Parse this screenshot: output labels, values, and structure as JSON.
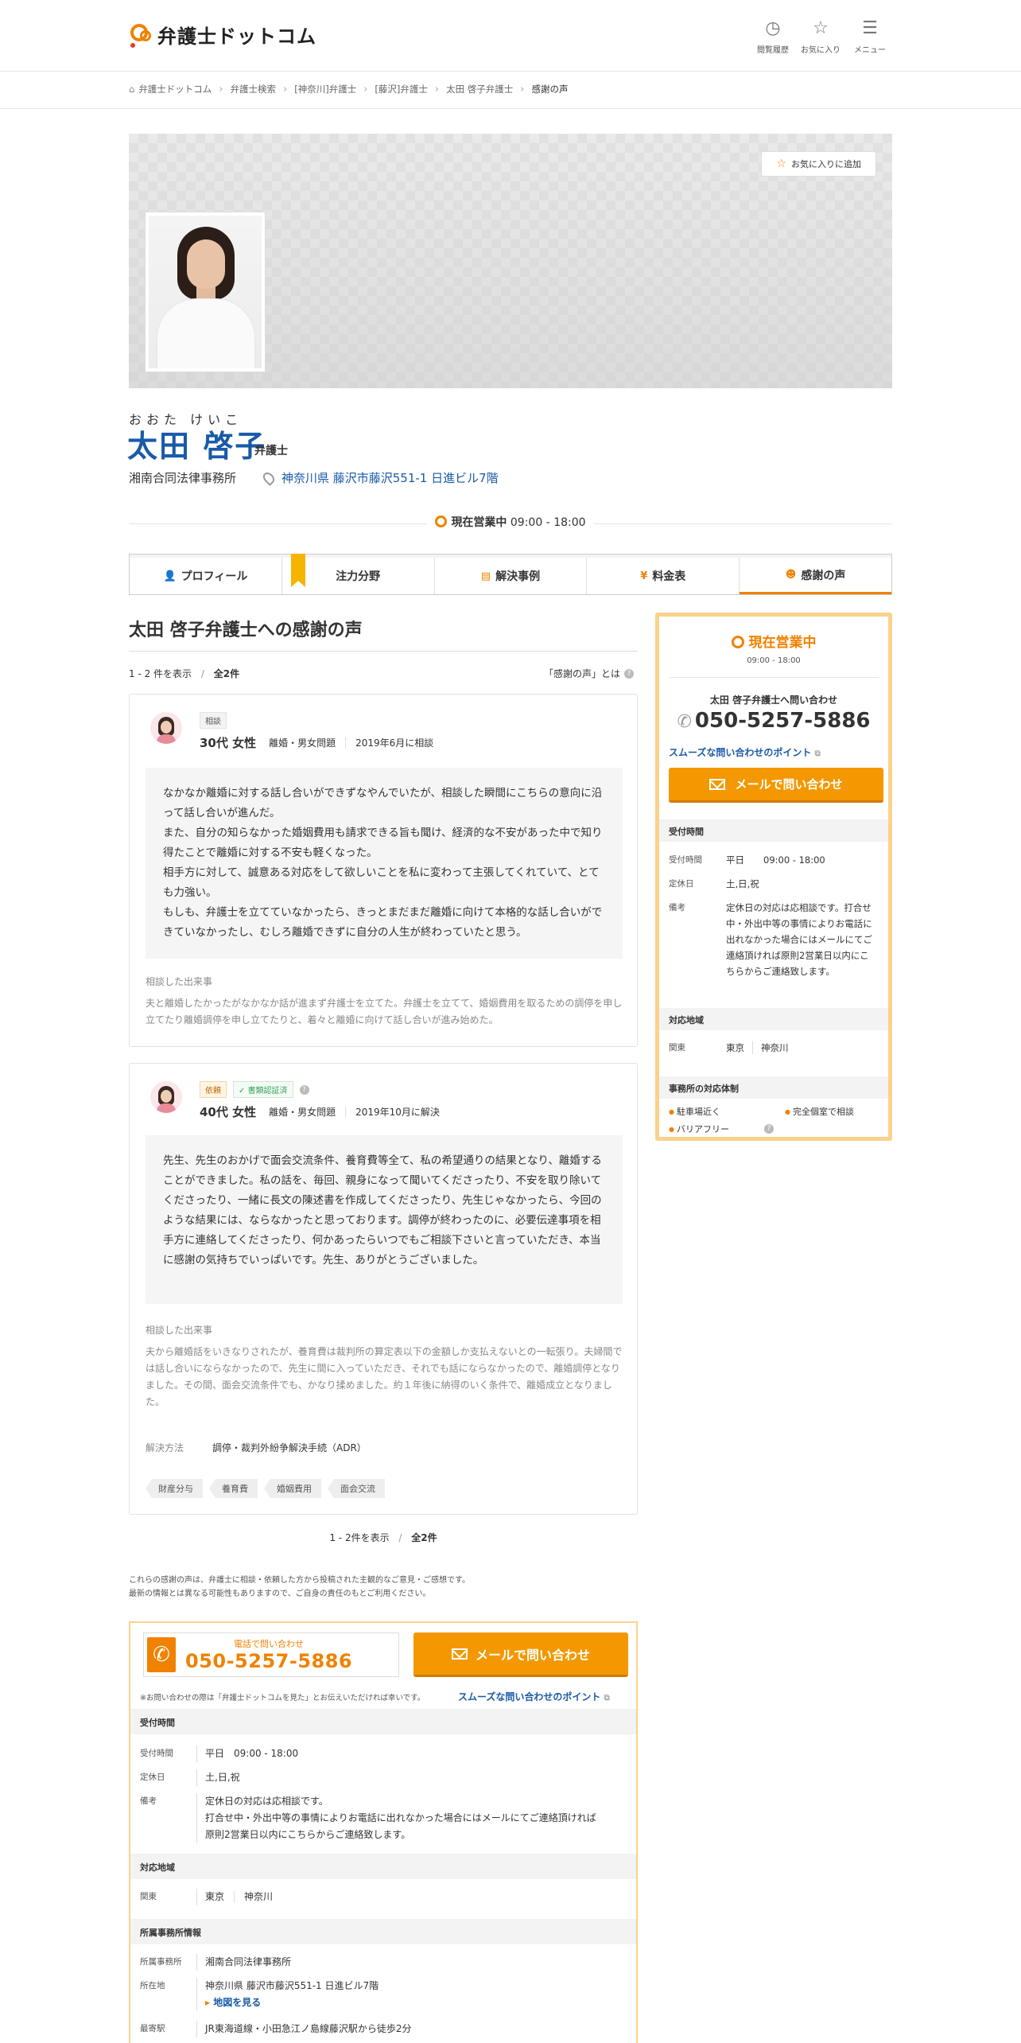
{
  "header": {
    "logo_text": "弁護士ドットコム",
    "nav": [
      {
        "label": "閲覧履歴",
        "icon": "history-icon"
      },
      {
        "label": "お気に入り",
        "icon": "star-icon"
      },
      {
        "label": "メニュー",
        "icon": "menu-icon"
      }
    ]
  },
  "breadcrumb": [
    "弁護士ドットコム",
    "弁護士検索",
    "[神奈川]弁護士",
    "[藤沢]弁護士",
    "太田 啓子弁護士",
    "感謝の声"
  ],
  "hero": {
    "favorite_label": "お気に入りに追加"
  },
  "profile": {
    "kana": "おおた けいこ",
    "name": "太田 啓子",
    "role": "弁護士",
    "office": "湘南合同法律事務所",
    "address": "神奈川県 藤沢市藤沢551-1 日進ビル7階",
    "status": "現在営業中",
    "hours": "09:00 - 18:00"
  },
  "tabs": [
    {
      "label": "プロフィール",
      "icon": "person-icon"
    },
    {
      "label": "注力分野",
      "icon": ""
    },
    {
      "label": "解決事例",
      "icon": "document-icon"
    },
    {
      "label": "料金表",
      "icon": "yen-icon"
    },
    {
      "label": "感謝の声",
      "icon": "smile-icon",
      "active": true
    }
  ],
  "main": {
    "title": "太田 啓子弁護士への感謝の声",
    "count_prefix": "1 - 2 件を表示",
    "count_sep": "/",
    "count_total": "全2件",
    "about_label": "「感謝の声」とは",
    "reviews": [
      {
        "tag": "相談",
        "who": "30代 女性",
        "category": "離婚・男女問題",
        "date": "2019年6月に相談",
        "quote": "なかなか離婚に対する話し合いができずなやんでいたが、相談した瞬間にこちらの意向に沿って話し合いが進んだ。\nまた、自分の知らなかった婚姻費用も請求できる旨も聞け、経済的な不安があった中で知り得たことで離婚に対する不安も軽くなった。\n相手方に対して、誠意ある対応をして欲しいことを私に変わって主張してくれていて、とても力強い。\nもしも、弁護士を立てていなかったら、きっとまだまだ離婚に向けて本格的な話し合いができていなかったし、むしろ離婚できずに自分の人生が終わっていたと思う。",
        "event_label": "相談した出来事",
        "event": "夫と離婚したかったがなかなか話が進まず弁護士を立てた。弁護士を立てて、婚姻費用を取るための調停を申し立てたり離婚調停を申し立てたりと、着々と離婚に向けて話し合いが進み始めた。"
      },
      {
        "tag": "依頼",
        "cert": "書類認証済",
        "who": "40代 女性",
        "category": "離婚・男女問題",
        "date": "2019年10月に解決",
        "quote": "先生、先生のおかげで面会交流条件、養育費等全て、私の希望通りの結果となり、離婚することができました。私の話を、毎回、親身になって聞いてくださったり、不安を取り除いてくださったり、一緒に長文の陳述書を作成してくださったり、先生じゃなかったら、今回のような結果には、ならなかったと思っております。調停が終わったのに、必要伝達事項を相手方に連絡してくださったり、何かあったらいつでもご相談下さいと言っていただき、本当に感謝の気持ちでいっぱいです。先生、ありがとうございました。",
        "event_label": "相談した出来事",
        "event": "夫から離婚話をいきなりされたが、養育費は裁判所の算定表以下の金額しか支払えないとの一転張り。夫婦間では話し合いにならなかったので、先生に間に入っていただき、それでも話にならなかったので、離婚調停となりました。その間、面会交流条件でも、かなり揉めました。約１年後に納得のいく条件で、離婚成立となりました。",
        "method_label": "解決方法",
        "method": "調停・裁判外紛争解決手続（ADR）",
        "chips": [
          "財産分与",
          "養育費",
          "婚姻費用",
          "面会交流"
        ]
      }
    ],
    "pager_prefix": "1 - 2件を表示",
    "pager_sep": "/",
    "pager_total": "全2件",
    "disclaimer_1": "これらの感謝の声は、弁護士に相談・依頼した方から投稿された主観的なご意見・ご感想です。",
    "disclaimer_2": "最新の情報とは異なる可能性もありますので、ご自身の責任のもとご利用ください。"
  },
  "sidebar": {
    "status": "現在営業中",
    "hours": "09:00 - 18:00",
    "ask": "太田 啓子弁護士へ問い合わせ",
    "tel": "050-5257-5886",
    "point": "スムーズな問い合わせのポイント",
    "mail": "メールで問い合わせ",
    "sec_reception": "受付時間",
    "reception_k": "受付時間",
    "reception_v1": "平日",
    "reception_v2": "09:00 - 18:00",
    "holiday_k": "定休日",
    "holiday_v": "土,日,祝",
    "note_k": "備考",
    "note_v": "定休日の対応は応相談です。打合せ中・外出中等の事情によりお電話に出れなかった場合にはメールにてご連絡頂ければ原則2営業日以内にこちらからご連絡致します。",
    "sec_area": "対応地域",
    "area_k": "関東",
    "area_v1": "東京",
    "area_v2": "神奈川",
    "sec_features": "事務所の対応体制",
    "features": [
      "駐車場近く",
      "完全個室で相談",
      "バリアフリー"
    ]
  },
  "contact": {
    "tel_label": "電話で問い合わせ",
    "tel": "050-5257-5886",
    "mail": "メールで問い合わせ",
    "note": "※お問い合わせの際は「弁護士ドットコムを見た」とお伝えいただければ幸いです。",
    "point": "スムーズな問い合わせのポイント",
    "sec_reception": "受付時間",
    "reception_k": "受付時間",
    "reception_v": "平日　09:00 - 18:00",
    "holiday_k": "定休日",
    "holiday_v": "土,日,祝",
    "note_k": "備考",
    "note_v1": "定休日の対応は応相談です。",
    "note_v2": "打合せ中・外出中等の事情によりお電話に出れなかった場合にはメールにてご連絡頂ければ",
    "note_v3": "原則2営業日以内にこちらからご連絡致します。",
    "sec_area": "対応地域",
    "area_k": "関東",
    "area_v1": "東京",
    "area_v2": "神奈川",
    "sec_office": "所属事務所情報",
    "office_k": "所属事務所",
    "office_v": "湘南合同法律事務所",
    "loc_k": "所在地",
    "loc_v": "神奈川県 藤沢市藤沢551-1 日進ビル7階",
    "map": "地図を見る",
    "station_k": "最寄駅",
    "station_v": "JR東海道線・小田急江ノ島線藤沢駅から徒歩2分"
  }
}
